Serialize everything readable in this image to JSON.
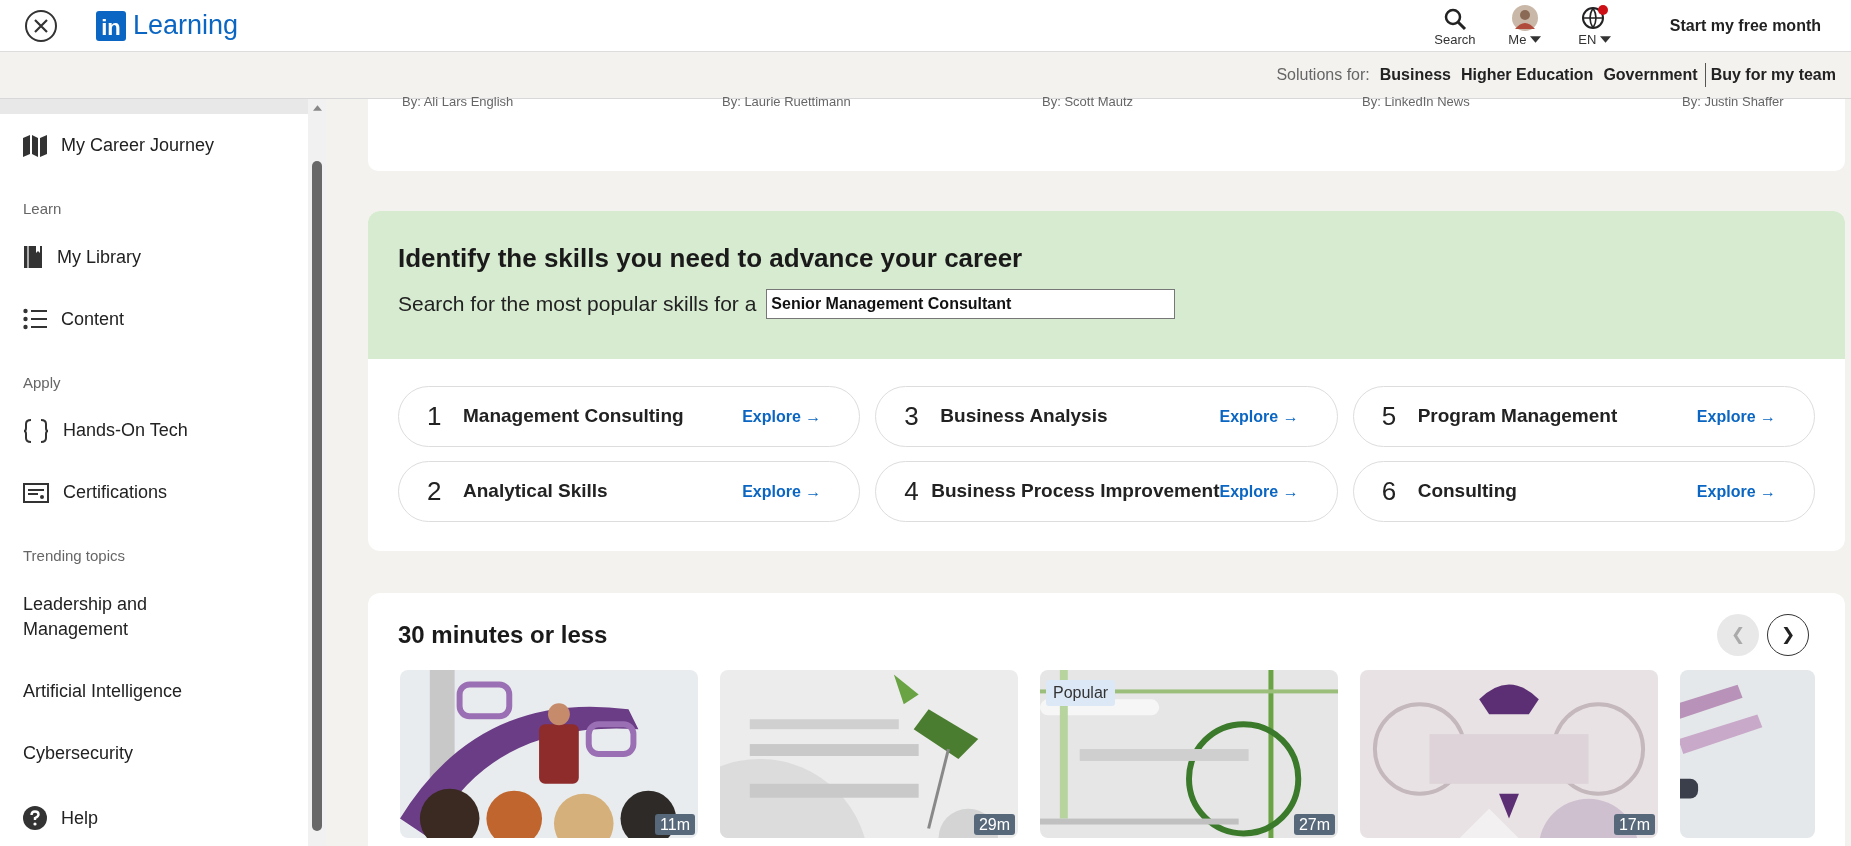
{
  "header": {
    "logo_mark": "in",
    "logo_text": "Learning",
    "nav": [
      {
        "kind": "search",
        "label": "Search",
        "dropdown": false
      },
      {
        "kind": "avatar",
        "label": "Me",
        "dropdown": true
      },
      {
        "kind": "language",
        "label": "EN",
        "dropdown": true
      }
    ],
    "cta": "Start my free month"
  },
  "solutions_bar": {
    "label": "Solutions for:",
    "links": [
      "Business",
      "Higher Education",
      "Government",
      "Buy for my team"
    ]
  },
  "sidebar": {
    "sections": [
      {
        "items": [
          {
            "kind": "map",
            "label": "My Career Journey"
          }
        ]
      },
      {
        "heading": "Learn",
        "items": [
          {
            "kind": "book",
            "label": "My Library"
          },
          {
            "kind": "list",
            "label": "Content"
          }
        ]
      },
      {
        "heading": "Apply",
        "items": [
          {
            "kind": "braces",
            "label": "Hands-On Tech"
          },
          {
            "kind": "certificate",
            "label": "Certifications"
          }
        ]
      },
      {
        "heading": "Trending topics",
        "items": [
          {
            "kind": "plain",
            "label": "Leadership and Management"
          },
          {
            "kind": "plain",
            "label": "Artificial Intelligence"
          },
          {
            "kind": "plain",
            "label": "Cybersecurity"
          }
        ]
      },
      {
        "items": [
          {
            "kind": "help",
            "label": "Help"
          }
        ]
      }
    ]
  },
  "featured_authors": [
    "By: Ali Lars English",
    "By: Laurie Ruettimann",
    "By: Scott Mautz",
    "By: LinkedIn News",
    "By: Justin Shaffer"
  ],
  "skills": {
    "title": "Identify the skills you need to advance your career",
    "prompt": "Search for the most popular skills for a",
    "input_value": "Senior Management Consultant",
    "items": [
      {
        "rank": "1",
        "name": "Management Consulting",
        "action": "Explore →"
      },
      {
        "rank": "2",
        "name": "Analytical Skills",
        "action": "Explore →"
      },
      {
        "rank": "3",
        "name": "Business Analysis",
        "action": "Explore →"
      },
      {
        "rank": "4",
        "name": "Business Process Improvement",
        "action": "Explore →"
      },
      {
        "rank": "5",
        "name": "Program Management",
        "action": "Explore →"
      },
      {
        "rank": "6",
        "name": "Consulting",
        "action": "Explore →"
      }
    ]
  },
  "short_courses": {
    "title": "30 minutes or less",
    "prev": {
      "label": "❮",
      "disabled": true
    },
    "next": {
      "label": "❯",
      "disabled": false
    },
    "items": [
      {
        "kind": "picture",
        "duration": "11m"
      },
      {
        "kind": "picture",
        "duration": "29m"
      },
      {
        "kind": "picture",
        "duration": "27m",
        "badge": "Popular"
      },
      {
        "kind": "picture",
        "duration": "17m"
      },
      {
        "kind": "picture"
      }
    ]
  }
}
